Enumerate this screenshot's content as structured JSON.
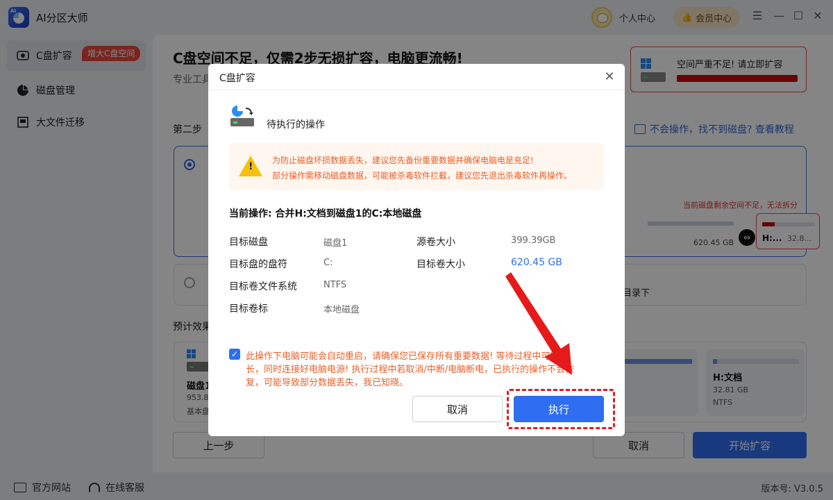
{
  "app": {
    "title": "AI分区大师",
    "logo_text": "AI"
  },
  "titlebar": {
    "user_center": "个人中心",
    "vip_center": "会员中心"
  },
  "sidebar": {
    "items": [
      {
        "label": "C盘扩容",
        "icon": "drive-icon"
      },
      {
        "label": "磁盘管理",
        "icon": "pie-chart-icon"
      },
      {
        "label": "大文件迁移",
        "icon": "migrate-icon"
      }
    ],
    "promo": "增大C盘空间"
  },
  "main": {
    "headline": "C盘空间不足，仅需2步无损扩容，电脑更流畅!",
    "subline": "专业工具",
    "alert": {
      "text": "空间严重不足! 请立即扩容"
    },
    "step_label": "第二步",
    "help_link": "不会操作，找不到磁盘? 查看教程",
    "option1": {
      "warn": "当前磁盘剩余空间不足，无法拆分",
      "c_size": "620.45 GB",
      "h_label": "H:...",
      "h_size": "32.8..."
    },
    "option2": {
      "text": "目录下"
    },
    "preview_label": "预计效果",
    "preview": {
      "disk_name": "磁盘1",
      "disk_size": "953.8",
      "disk_type": "基本盘",
      "partitions": [
        {
          "name": "盘",
          "size": "GB",
          "fs": "",
          "fill_percent": 100
        },
        {
          "name": "H:文档",
          "size": "32.81 GB",
          "fs": "NTFS",
          "fill_percent": 5
        }
      ]
    },
    "buttons": {
      "prev": "上一步",
      "cancel": "取消",
      "start": "开始扩容"
    }
  },
  "footer": {
    "website": "官方网站",
    "support": "在线客服",
    "version": "版本号: V3.0.5"
  },
  "dialog": {
    "title": "C盘扩容",
    "pending_title": "待执行的操作",
    "warning_lines": [
      "为防止磁盘坏损数据丢失，建议您先备份重要数据并确保电脑电是充足!",
      "部分操作需移动磁盘数据，可能被杀毒软件拦截，建议您先退出杀毒软件再操作。"
    ],
    "current_op": "当前操作: 合并H:文档到磁盘1的C:本地磁盘",
    "fields": {
      "target_disk": {
        "label": "目标磁盘",
        "value": "磁盘1"
      },
      "target_letter": {
        "label": "目标盘的盘符",
        "value": "C:"
      },
      "target_fs": {
        "label": "目标卷文件系统",
        "value": "NTFS"
      },
      "target_vol_label": {
        "label": "目标卷标",
        "value": "本地磁盘"
      },
      "src_vol_size": {
        "label": "源卷大小",
        "value": "399.39GB"
      },
      "target_vol_size": {
        "label": "目标卷大小",
        "value": "620.45 GB"
      }
    },
    "agree_lines": [
      "此操作下电脑可能会自动重启，请确保您已保存所有重要数据! 等待过程中可能较",
      "长，同时连接好电脑电源! 执行过程中若取消/中断/电脑断电，已执行的操作不会恢",
      "复，可能导致部分数据丢失，我已知晓。"
    ],
    "checkbox_checked": true,
    "cancel": "取消",
    "execute": "执行"
  },
  "colors": {
    "accent": "#2f6ef0",
    "warning": "#e8602a",
    "danger": "#e61a1a"
  }
}
